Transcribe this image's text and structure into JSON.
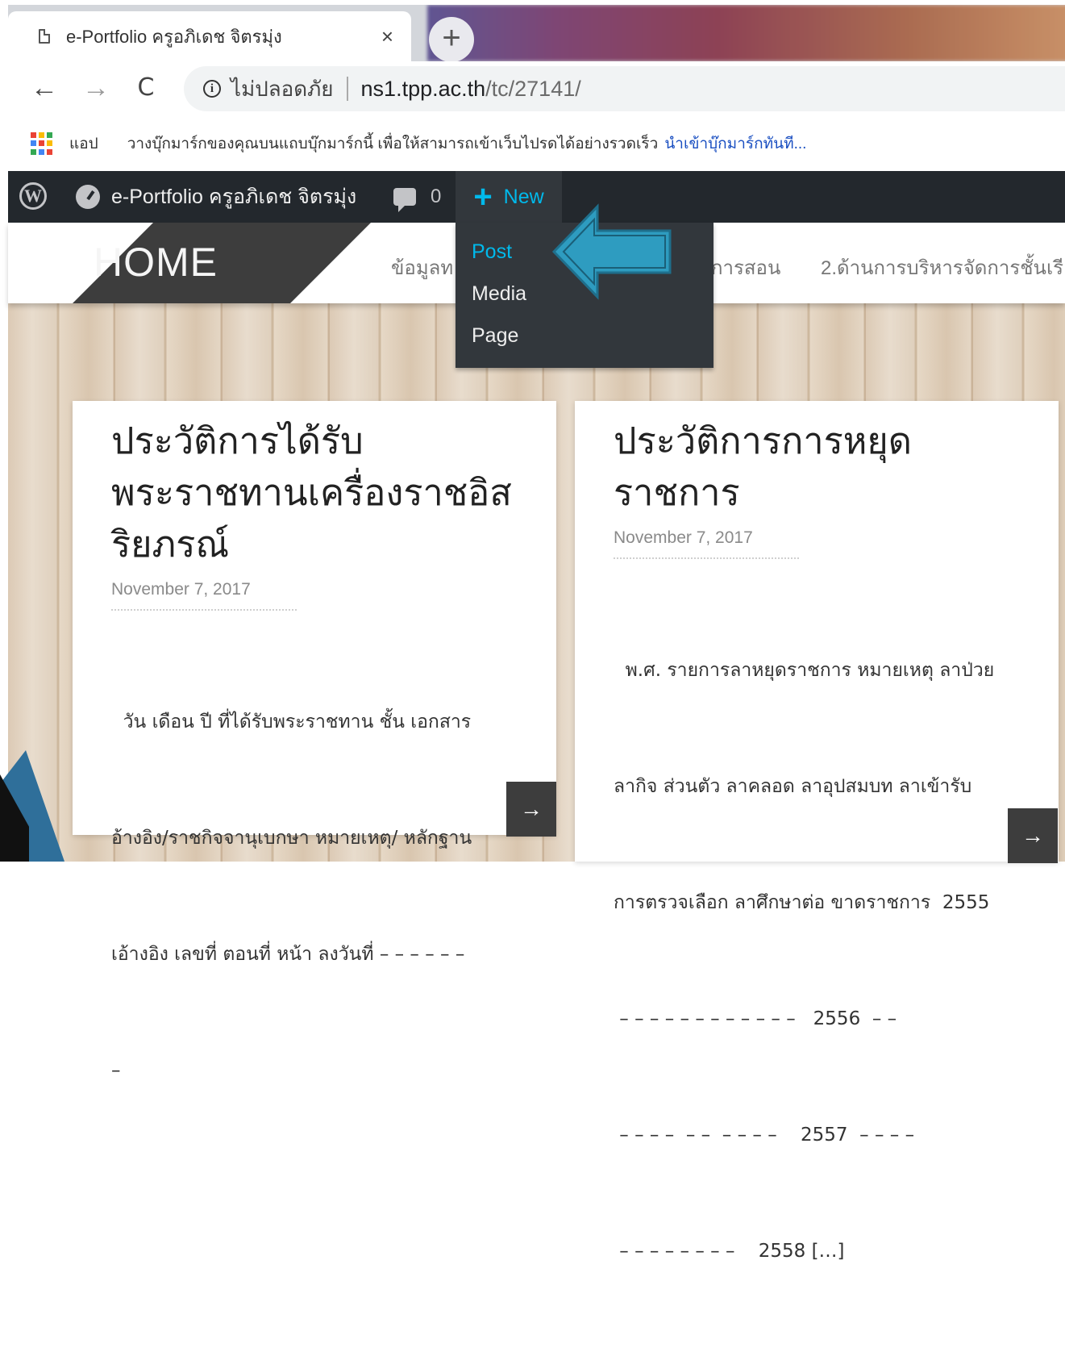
{
  "browser": {
    "tab_title": "e-Portfolio ครูอภิเดช จิตรมุ่ง",
    "close_glyph": "×",
    "newtab_glyph": "+",
    "back_glyph": "←",
    "forward_glyph": "→",
    "reload_glyph": "C",
    "security_label": "ไม่ปลอดภัย",
    "url_host": "ns1.tpp.ac.th",
    "url_path": "/tc/27141/"
  },
  "bookmarks": {
    "apps_label": "แอป",
    "hint": "วางบุ๊กมาร์กของคุณบนแถบบุ๊กมาร์กนี้ เพื่อให้สามารถเข้าเว็บไปรดได้อย่างรวดเร็ว",
    "import_link": "นำเข้าบุ๊กมาร์กทันที..."
  },
  "adminbar": {
    "site_name": "e-Portfolio ครูอภิเดช จิตรมุ่ง",
    "comment_count": "0",
    "new_label": "New",
    "new_menu": [
      "Post",
      "Media",
      "Page"
    ]
  },
  "site": {
    "logo": "HOME",
    "menu": [
      "ข้อมูลท",
      "การสอน",
      "2.ด้านการบริหารจัดการชั้นเรี"
    ]
  },
  "posts": [
    {
      "title": "ประวัติการได้รับพระราชทานเครื่องราชอิสริยภรณ์",
      "title_lines": [
        "ประวัติการได้รับ",
        "พระราชทานเครื่องราชอิส",
        "ริยภรณ์"
      ],
      "date": "November 7, 2017",
      "excerpt_lines": [
        "  วัน เดือน ปี ที่ได้รับพระราชทาน ชั้น เอกสาร",
        "อ้างอิง/ราชกิจจานุเบกษา หมายเหตุ/ หลักฐาน",
        "เอ้างอิง เลขที่ ตอนที่ หน้า ลงวันที่ – – – – – –",
        "–"
      ]
    },
    {
      "title": "ประวัติการการหยุดราชการ",
      "title_lines": [
        "ประวัติการการหยุด",
        "ราชการ"
      ],
      "date": "November 7, 2017",
      "excerpt_lines": [
        "  พ.ศ. รายการลาหยุดราชการ หมายเหตุ ลาป่วย",
        "ลากิจ ส่วนตัว ลาคลอด ลาอุปสมบท ลาเข้ารับ",
        "การตรวจเลือก ลาศึกษาต่อ ขาดราชการ  2555",
        " – – – – – – – – – – – –   2556  – –",
        " – – – –  – –  – – – –    2557  – – – –",
        " – – – – – – – –    2558 […]"
      ]
    }
  ],
  "more_glyph": "→",
  "colors": {
    "adminbar_bg": "#23282d",
    "dropdown_bg": "#32373c",
    "wp_accent": "#00b9eb",
    "arrow_fill": "#2e9cc0"
  },
  "icons": [
    "page-icon",
    "close-icon",
    "plus-icon",
    "back-arrow-icon",
    "forward-arrow-icon",
    "reload-icon",
    "info-icon",
    "apps-grid-icon",
    "wordpress-logo-icon",
    "dashboard-icon",
    "comment-bubble-icon",
    "callout-arrow-icon"
  ]
}
